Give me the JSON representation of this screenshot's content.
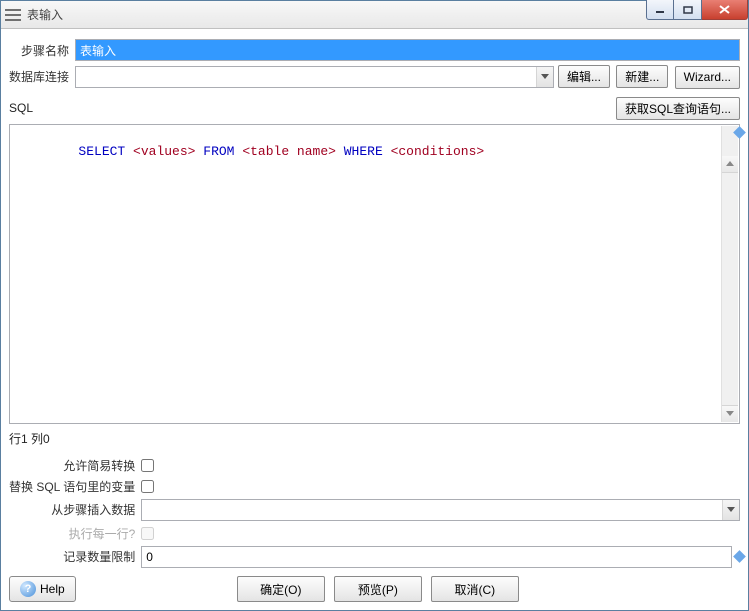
{
  "window": {
    "title": "表输入"
  },
  "form": {
    "step_name_label": "步骤名称",
    "step_name_value": "表输入",
    "db_conn_label": "数据库连接",
    "db_conn_value": "",
    "edit_btn": "编辑...",
    "new_btn": "新建...",
    "wizard_btn": "Wizard..."
  },
  "sql": {
    "label": "SQL",
    "get_sql_btn": "获取SQL查询语句...",
    "tokens": [
      {
        "t": "SELECT",
        "c": "kw"
      },
      {
        "t": " ",
        "c": ""
      },
      {
        "t": "<values>",
        "c": "ph"
      },
      {
        "t": " ",
        "c": ""
      },
      {
        "t": "FROM",
        "c": "kw"
      },
      {
        "t": " ",
        "c": ""
      },
      {
        "t": "<table name>",
        "c": "ph"
      },
      {
        "t": " ",
        "c": ""
      },
      {
        "t": "WHERE",
        "c": "kw"
      },
      {
        "t": " ",
        "c": ""
      },
      {
        "t": "<conditions>",
        "c": "ph"
      }
    ],
    "cursor_pos": "行1 列0"
  },
  "opts": {
    "lazy_label": "允许简易转换",
    "lazy_checked": false,
    "repl_vars_label": "替换 SQL 语句里的变量",
    "repl_vars_checked": false,
    "insert_from_label": "从步骤插入数据",
    "insert_from_value": "",
    "exec_each_label": "执行每一行?",
    "exec_each_checked": false,
    "limit_label": "记录数量限制",
    "limit_value": "0"
  },
  "footer": {
    "help": "Help",
    "ok": "确定(O)",
    "preview": "预览(P)",
    "cancel": "取消(C)"
  }
}
